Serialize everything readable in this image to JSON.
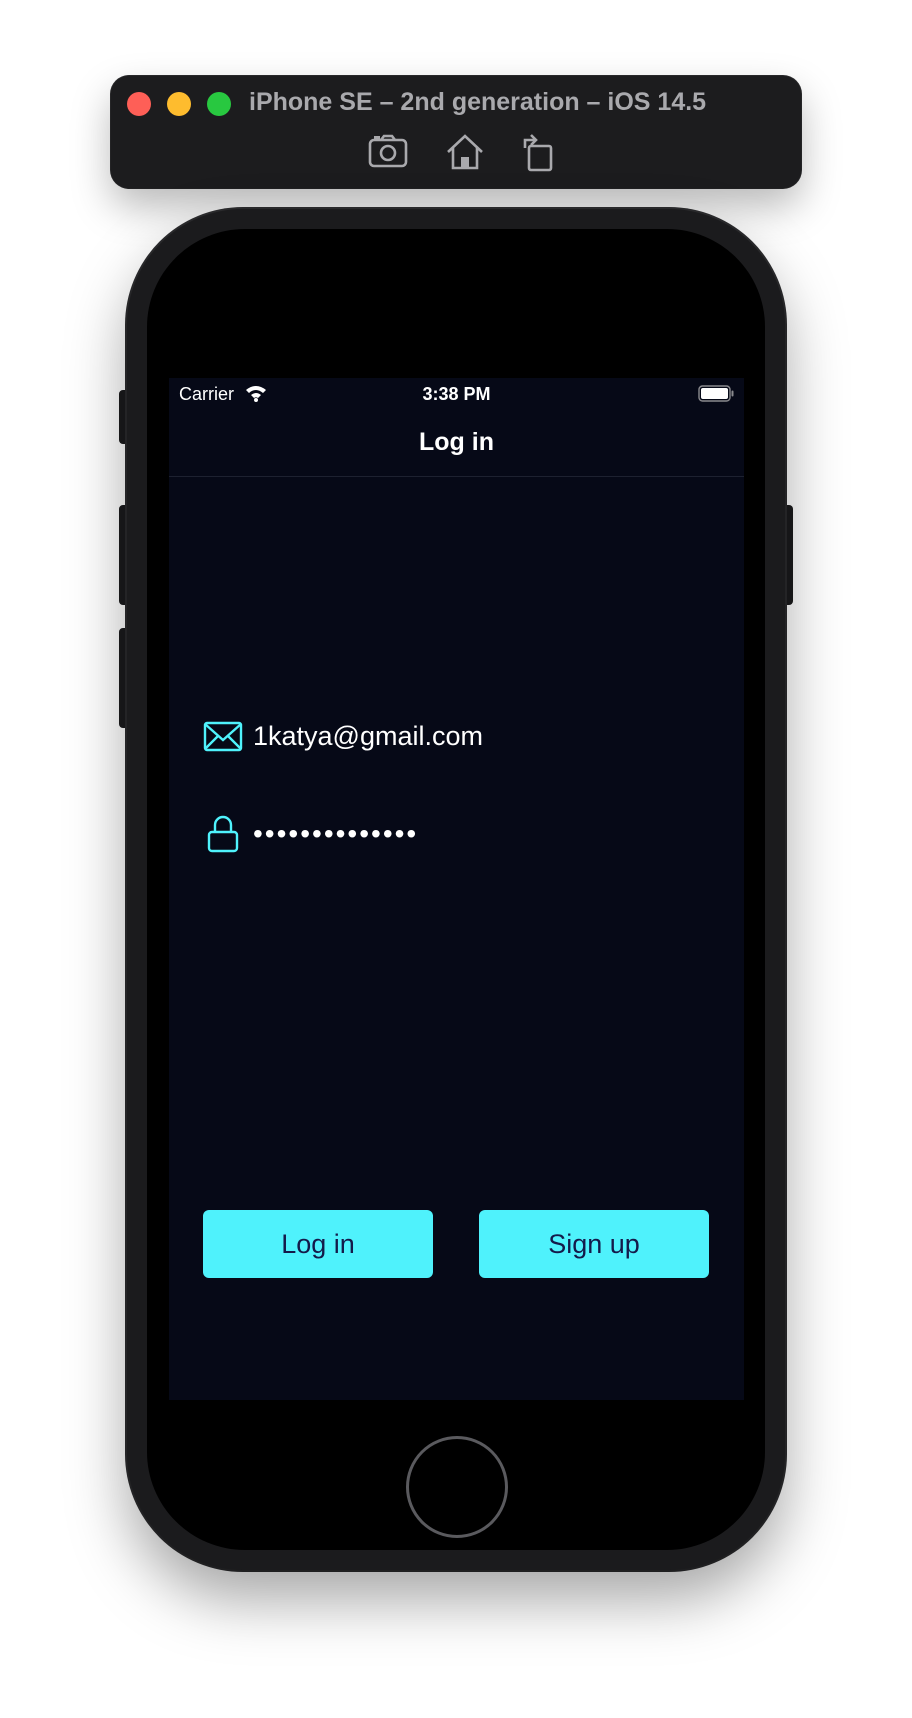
{
  "simulator": {
    "title": "iPhone SE – 2nd generation – iOS 14.5",
    "tools": [
      "screenshot-icon",
      "home-icon",
      "rotate-icon"
    ]
  },
  "status_bar": {
    "carrier": "Carrier",
    "time": "3:38 PM"
  },
  "nav": {
    "title": "Log in"
  },
  "form": {
    "email_value": "1katya@gmail.com",
    "password_value": "••••••••••••••"
  },
  "buttons": {
    "login_label": "Log in",
    "signup_label": "Sign up"
  },
  "colors": {
    "accent": "#4ff2fc",
    "background": "#060917",
    "button_text": "#141a4a"
  }
}
